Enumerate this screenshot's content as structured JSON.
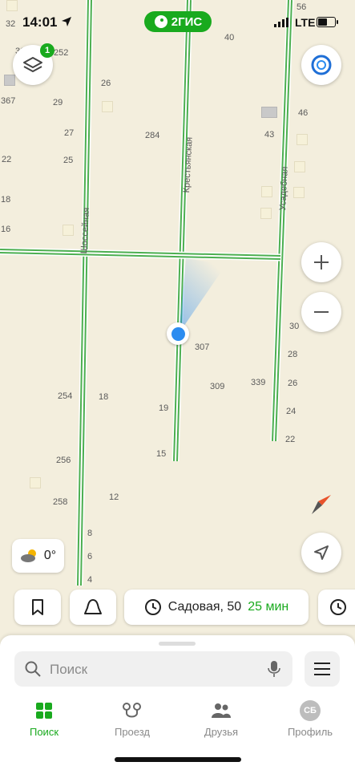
{
  "status_bar": {
    "time": "14:01",
    "network": "LTE",
    "brand": "2ГИС"
  },
  "map": {
    "streets": [
      "Шоссейная",
      "Крестьянская",
      "Усадебная"
    ],
    "house_numbers": [
      "32",
      "36",
      "252",
      "40",
      "56",
      "367",
      "29",
      "26",
      "46",
      "43",
      "284",
      "27",
      "22",
      "25",
      "18",
      "16",
      "30",
      "307",
      "28",
      "309",
      "339",
      "26",
      "254",
      "18",
      "19",
      "24",
      "22",
      "15",
      "256",
      "258",
      "12",
      "8",
      "6",
      "4"
    ],
    "layers_badge": "1"
  },
  "weather": {
    "temperature": "0°"
  },
  "route_chip": {
    "destination": "Садовая, 50",
    "duration": "25 мин"
  },
  "search": {
    "placeholder": "Поиск"
  },
  "tabs": [
    {
      "label": "Поиск",
      "icon": "grid-icon",
      "active": true
    },
    {
      "label": "Проезд",
      "icon": "route-icon"
    },
    {
      "label": "Друзья",
      "icon": "friends-icon"
    },
    {
      "label": "Профиль",
      "icon": "avatar",
      "initials": "СБ"
    }
  ],
  "colors": {
    "accent": "#19aa1e",
    "road": "#4caf50",
    "map_bg": "#f3eedd",
    "location": "#2b8cf0"
  }
}
